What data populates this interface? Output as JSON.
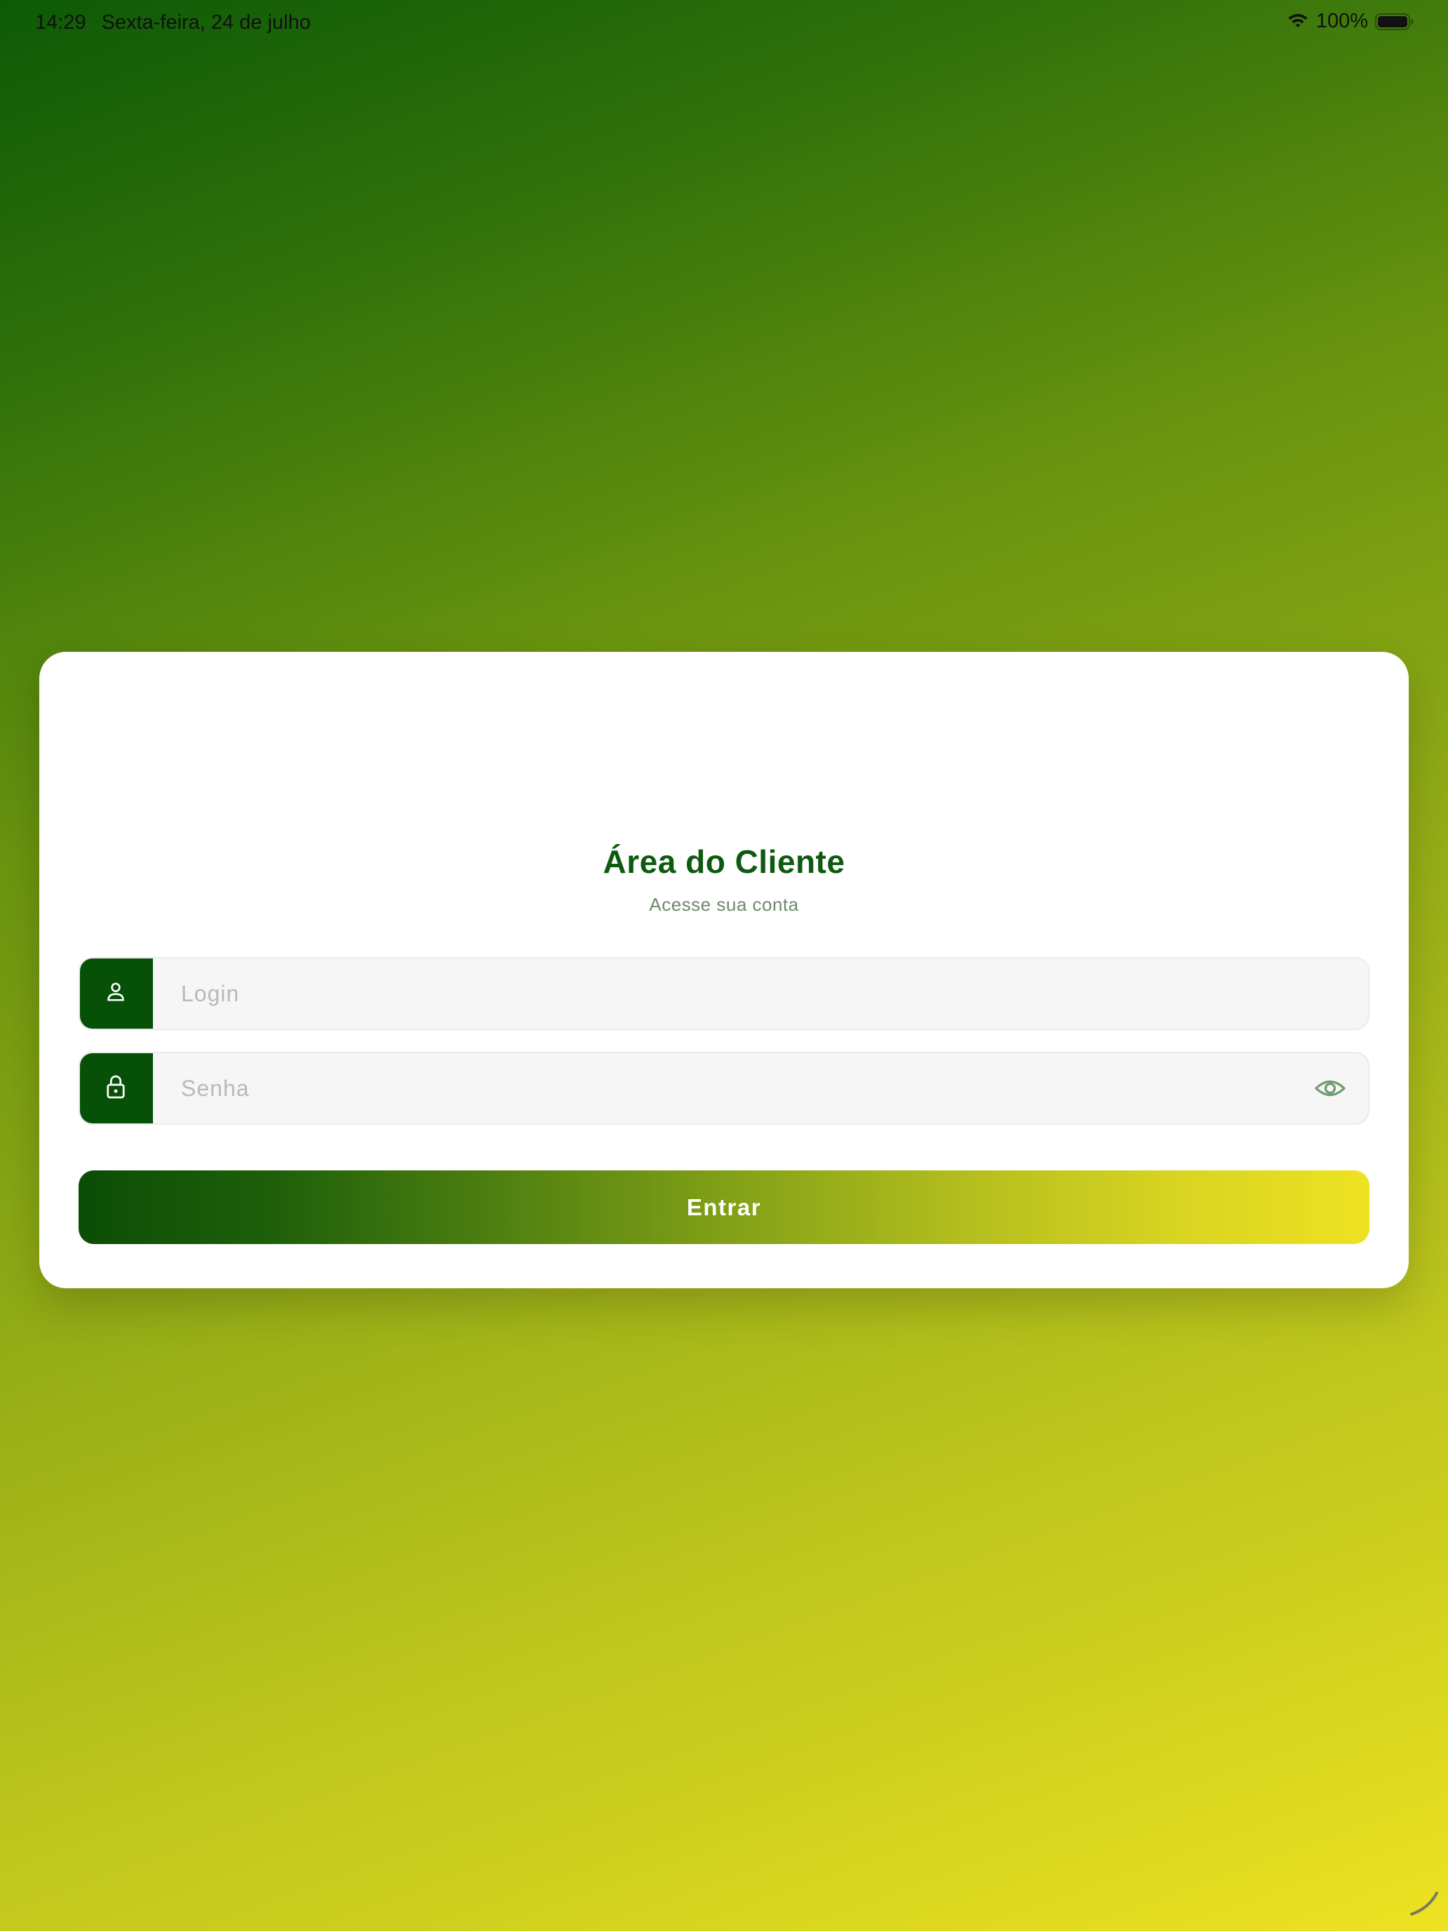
{
  "status_bar": {
    "time": "14:29",
    "date": "Sexta-feira, 24 de julho",
    "battery_percent": "100%",
    "battery_level": 1.0,
    "icons": [
      "wifi-icon",
      "battery-icon"
    ]
  },
  "login_card": {
    "title": "Área do Cliente",
    "subtitle": "Acesse sua conta",
    "login_field": {
      "placeholder": "Login",
      "value": "",
      "icon": "user-icon"
    },
    "password_field": {
      "placeholder": "Senha",
      "value": "",
      "icon": "lock-icon",
      "toggle_icon": "eye-icon"
    },
    "submit_label": "Entrar"
  },
  "colors": {
    "brand_dark_green": "#075008",
    "title_green": "#0e5a10",
    "accent_yellow": "#eee222",
    "card_background": "#ffffff",
    "field_background": "#f6f6f6"
  }
}
